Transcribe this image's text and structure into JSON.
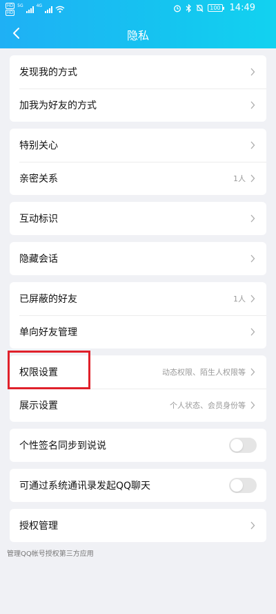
{
  "status_bar": {
    "left_badges": [
      "HD",
      "HD"
    ],
    "net_labels": [
      "5G",
      "4G"
    ],
    "battery": "100",
    "time": "14:49"
  },
  "nav": {
    "back_icon": "chevron-left-icon",
    "title": "隐私"
  },
  "groups": [
    {
      "items": [
        {
          "label": "发现我的方式",
          "value": ""
        },
        {
          "label": "加我为好友的方式",
          "value": ""
        }
      ]
    },
    {
      "items": [
        {
          "label": "特别关心",
          "value": ""
        },
        {
          "label": "亲密关系",
          "value": "1人"
        }
      ]
    },
    {
      "items": [
        {
          "label": "互动标识",
          "value": ""
        }
      ]
    },
    {
      "items": [
        {
          "label": "隐藏会话",
          "value": ""
        }
      ]
    },
    {
      "items": [
        {
          "label": "已屏蔽的好友",
          "value": "1人"
        },
        {
          "label": "单向好友管理",
          "value": ""
        }
      ]
    },
    {
      "items": [
        {
          "label": "权限设置",
          "value": "动态权限、陌生人权限等"
        },
        {
          "label": "展示设置",
          "value": "个人状态、会员身份等"
        }
      ]
    }
  ],
  "toggles": [
    {
      "label": "个性签名同步到说说",
      "on": false
    },
    {
      "label": "可通过系统通讯录发起QQ聊天",
      "on": false
    }
  ],
  "auth": {
    "label": "授权管理",
    "note": "管理QQ帐号授权第三方应用"
  },
  "colors": {
    "header_start": "#1fb0f5",
    "header_end": "#12d2f0",
    "background": "#f0f1f5",
    "highlight": "#e0202a"
  }
}
